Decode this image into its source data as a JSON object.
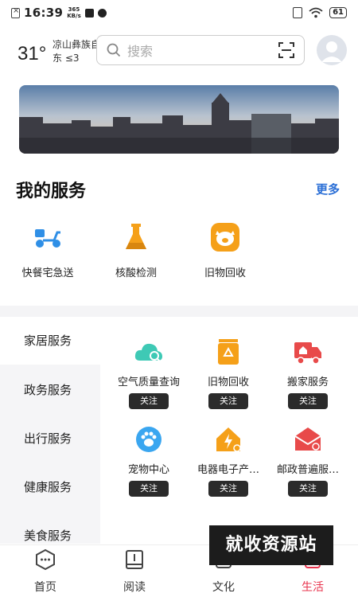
{
  "status_bar": {
    "time": "16:39",
    "net_speed_top": "365",
    "net_speed_bottom": "KB/s",
    "battery": "61"
  },
  "header": {
    "temperature": "31°",
    "location_line1": "凉山彝族自治州",
    "location_line2": "东 ≤3",
    "search_placeholder": "搜索"
  },
  "my_services": {
    "title": "我的服务",
    "more_label": "更多",
    "items": [
      {
        "label": "快餐宅急送",
        "icon": "delivery-scooter-icon",
        "color": "#2f8fe6"
      },
      {
        "label": "核酸检测",
        "icon": "flask-icon",
        "color": "#f5a019"
      },
      {
        "label": "旧物回收",
        "icon": "pig-recycle-icon",
        "color": "#f5a019"
      }
    ]
  },
  "categories": [
    {
      "label": "家居服务",
      "active": true
    },
    {
      "label": "政务服务",
      "active": false
    },
    {
      "label": "出行服务",
      "active": false
    },
    {
      "label": "健康服务",
      "active": false
    },
    {
      "label": "美食服务",
      "active": false
    }
  ],
  "services_grid": [
    {
      "label": "空气质量查询",
      "icon": "cloud-search-icon",
      "color": "#3ec9b5",
      "follow_label": "关注"
    },
    {
      "label": "旧物回收",
      "icon": "recycle-bin-icon",
      "color": "#f5a019",
      "follow_label": "关注"
    },
    {
      "label": "搬家服务",
      "icon": "moving-truck-icon",
      "color": "#e84a4a",
      "follow_label": "关注"
    },
    {
      "label": "宠物中心",
      "icon": "paw-icon",
      "color": "#3aa6f0",
      "follow_label": "关注"
    },
    {
      "label": "电器电子产…",
      "icon": "electric-house-icon",
      "color": "#f5a019",
      "follow_label": "关注"
    },
    {
      "label": "邮政普遍服…",
      "icon": "mail-search-icon",
      "color": "#e84a4a",
      "follow_label": "关注"
    }
  ],
  "watermark": "就收资源站",
  "bottom_nav": [
    {
      "label": "首页",
      "icon": "home-hex-icon",
      "active": false
    },
    {
      "label": "阅读",
      "icon": "book-icon",
      "active": false
    },
    {
      "label": "文化",
      "icon": "culture-icon",
      "active": false
    },
    {
      "label": "生活",
      "icon": "life-icon",
      "active": true
    }
  ],
  "colors": {
    "accent_blue": "#2b6fd6",
    "active_red": "#e8344e"
  }
}
